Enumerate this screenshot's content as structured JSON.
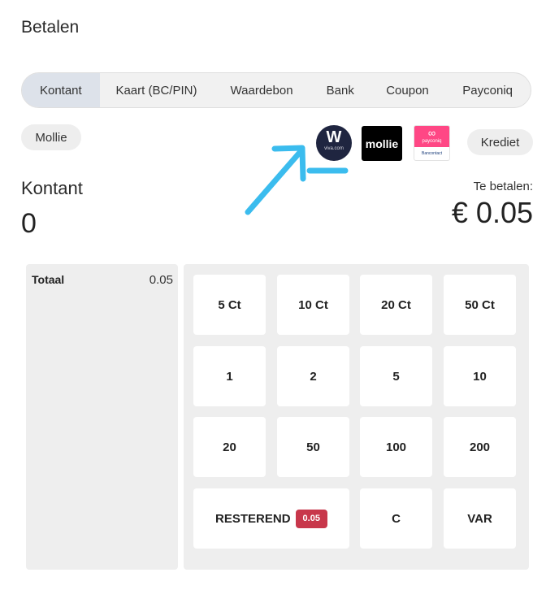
{
  "page": {
    "title": "Betalen"
  },
  "tabs": [
    {
      "label": "Kontant",
      "active": true
    },
    {
      "label": "Kaart (BC/PIN)",
      "active": false
    },
    {
      "label": "Waardebon",
      "active": false
    },
    {
      "label": "Bank",
      "active": false
    },
    {
      "label": "Coupon",
      "active": false
    },
    {
      "label": "Payconiq",
      "active": false
    }
  ],
  "extra_methods": {
    "mollie": "Mollie",
    "krediet": "Krediet"
  },
  "logos": {
    "viva": {
      "mark": "W",
      "text": "viva.com"
    },
    "mollie": {
      "text": "mollie"
    },
    "payconiq": {
      "mark": "∞",
      "text": "payconiq",
      "sub": "Bancontact"
    }
  },
  "annotation": {
    "color": "#3bbcee",
    "icon": "arrow-annotation-icon"
  },
  "amount": {
    "label": "Kontant",
    "value": "0"
  },
  "due": {
    "label": "Te betalen:",
    "value": "€ 0.05"
  },
  "summary": {
    "label": "Totaal",
    "value": "0.05"
  },
  "keypad": {
    "row1": [
      "5 Ct",
      "10 Ct",
      "20 Ct",
      "50 Ct"
    ],
    "row2": [
      "1",
      "2",
      "5",
      "10"
    ],
    "row3": [
      "20",
      "50",
      "100",
      "200"
    ],
    "row4": {
      "remaining_label": "RESTEREND",
      "remaining_value": "0.05",
      "clear": "C",
      "var": "VAR"
    }
  },
  "colors": {
    "accent_tab": "#dde2ea",
    "badge": "#c8374b",
    "panel": "#eeeeee"
  }
}
